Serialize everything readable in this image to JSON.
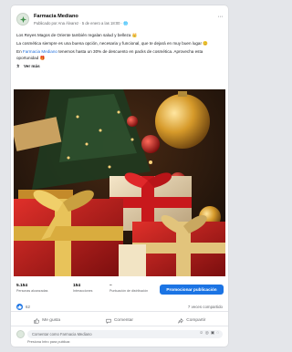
{
  "post": {
    "page_name": "Farmacia Mediano",
    "meta_text": "Publicado por Ana Álvarez · 5 de enero a las 18:00 · 🌐",
    "more_label": "···",
    "text_p1": "Los Reyes Magos de Oriente también regalan salud y belleza 👑",
    "text_p2": "La cosmética siempre es una buena opción, necesaria y funcional, que te dejará en muy buen lugar 😊",
    "text_p3_link": "Farmacia Mediano",
    "text_p3_rest": " tenemos hasta un 30% de descuento en packs de cosmética. Aprovecha esta oportunidad 🎁",
    "text_p3_prefix": "En ",
    "see_more": "Ver más",
    "image_alt": "Christmas gifts with red ribbons and gold ornaments"
  },
  "stats": {
    "reach_value": "5.154",
    "reach_label": "Personas alcanzadas",
    "interactions_value": "154",
    "interactions_label": "Interacciones",
    "distribution_value": "–",
    "distribution_label": "Puntuación de distribución",
    "promote_label": "Promocionar publicación"
  },
  "reactions": {
    "count": "62",
    "shares": "7 veces compartido"
  },
  "actions": {
    "like": "Me gusta",
    "comment": "Comentar",
    "share": "Compartir"
  },
  "comment_box": {
    "placeholder": "Comentar como Farmacia Mediano",
    "hint": "Presiona Intro para publicar."
  },
  "colors": {
    "accent": "#1b74e4",
    "link": "#216fdb"
  }
}
